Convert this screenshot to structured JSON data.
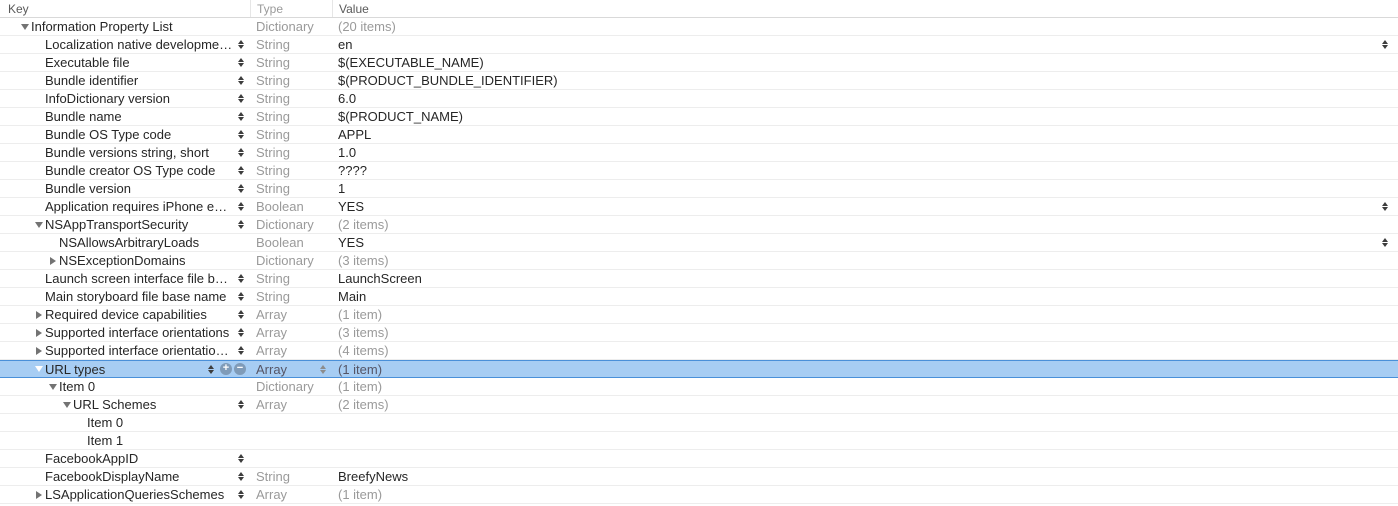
{
  "header": {
    "key": "Key",
    "type": "Type",
    "value": "Value"
  },
  "icons": {
    "plus": "+",
    "minus": "−"
  },
  "rows": [
    {
      "indent": 1,
      "arrow": "down",
      "key": "Information Property List",
      "keyStepper": false,
      "type": "Dictionary",
      "val": "(20 items)",
      "valGrey": true,
      "valStepper": false,
      "selected": false,
      "plusMinus": false
    },
    {
      "indent": 2,
      "arrow": "",
      "key": "Localization native development re...",
      "keyStepper": true,
      "type": "String",
      "val": "en",
      "valGrey": false,
      "valStepper": true,
      "selected": false,
      "plusMinus": false
    },
    {
      "indent": 2,
      "arrow": "",
      "key": "Executable file",
      "keyStepper": true,
      "type": "String",
      "val": "$(EXECUTABLE_NAME)",
      "valGrey": false,
      "valStepper": false,
      "selected": false,
      "plusMinus": false
    },
    {
      "indent": 2,
      "arrow": "",
      "key": "Bundle identifier",
      "keyStepper": true,
      "type": "String",
      "val": "$(PRODUCT_BUNDLE_IDENTIFIER)",
      "valGrey": false,
      "valStepper": false,
      "selected": false,
      "plusMinus": false
    },
    {
      "indent": 2,
      "arrow": "",
      "key": "InfoDictionary version",
      "keyStepper": true,
      "type": "String",
      "val": "6.0",
      "valGrey": false,
      "valStepper": false,
      "selected": false,
      "plusMinus": false
    },
    {
      "indent": 2,
      "arrow": "",
      "key": "Bundle name",
      "keyStepper": true,
      "type": "String",
      "val": "$(PRODUCT_NAME)",
      "valGrey": false,
      "valStepper": false,
      "selected": false,
      "plusMinus": false
    },
    {
      "indent": 2,
      "arrow": "",
      "key": "Bundle OS Type code",
      "keyStepper": true,
      "type": "String",
      "val": "APPL",
      "valGrey": false,
      "valStepper": false,
      "selected": false,
      "plusMinus": false
    },
    {
      "indent": 2,
      "arrow": "",
      "key": "Bundle versions string, short",
      "keyStepper": true,
      "type": "String",
      "val": "1.0",
      "valGrey": false,
      "valStepper": false,
      "selected": false,
      "plusMinus": false
    },
    {
      "indent": 2,
      "arrow": "",
      "key": "Bundle creator OS Type code",
      "keyStepper": true,
      "type": "String",
      "val": "????",
      "valGrey": false,
      "valStepper": false,
      "selected": false,
      "plusMinus": false
    },
    {
      "indent": 2,
      "arrow": "",
      "key": "Bundle version",
      "keyStepper": true,
      "type": "String",
      "val": "1",
      "valGrey": false,
      "valStepper": false,
      "selected": false,
      "plusMinus": false
    },
    {
      "indent": 2,
      "arrow": "",
      "key": "Application requires iPhone enviro...",
      "keyStepper": true,
      "type": "Boolean",
      "val": "YES",
      "valGrey": false,
      "valStepper": true,
      "selected": false,
      "plusMinus": false
    },
    {
      "indent": 2,
      "arrow": "down",
      "key": "NSAppTransportSecurity",
      "keyStepper": true,
      "type": "Dictionary",
      "val": "(2 items)",
      "valGrey": true,
      "valStepper": false,
      "selected": false,
      "plusMinus": false
    },
    {
      "indent": 3,
      "arrow": "",
      "key": "NSAllowsArbitraryLoads",
      "keyStepper": false,
      "type": "Boolean",
      "val": "YES",
      "valGrey": false,
      "valStepper": true,
      "selected": false,
      "plusMinus": false
    },
    {
      "indent": 3,
      "arrow": "right",
      "key": "NSExceptionDomains",
      "keyStepper": false,
      "type": "Dictionary",
      "val": "(3 items)",
      "valGrey": true,
      "valStepper": false,
      "selected": false,
      "plusMinus": false
    },
    {
      "indent": 2,
      "arrow": "",
      "key": "Launch screen interface file base...",
      "keyStepper": true,
      "type": "String",
      "val": "LaunchScreen",
      "valGrey": false,
      "valStepper": false,
      "selected": false,
      "plusMinus": false
    },
    {
      "indent": 2,
      "arrow": "",
      "key": "Main storyboard file base name",
      "keyStepper": true,
      "type": "String",
      "val": "Main",
      "valGrey": false,
      "valStepper": false,
      "selected": false,
      "plusMinus": false
    },
    {
      "indent": 2,
      "arrow": "right",
      "key": "Required device capabilities",
      "keyStepper": true,
      "type": "Array",
      "val": "(1 item)",
      "valGrey": true,
      "valStepper": false,
      "selected": false,
      "plusMinus": false
    },
    {
      "indent": 2,
      "arrow": "right",
      "key": "Supported interface orientations",
      "keyStepper": true,
      "type": "Array",
      "val": "(3 items)",
      "valGrey": true,
      "valStepper": false,
      "selected": false,
      "plusMinus": false
    },
    {
      "indent": 2,
      "arrow": "right",
      "key": "Supported interface orientations (i...",
      "keyStepper": true,
      "type": "Array",
      "val": "(4 items)",
      "valGrey": true,
      "valStepper": false,
      "selected": false,
      "plusMinus": false
    },
    {
      "indent": 2,
      "arrow": "down",
      "key": "URL types",
      "keyStepper": true,
      "type": "Array",
      "val": "(1 item)",
      "valGrey": true,
      "valStepper": false,
      "selected": true,
      "plusMinus": true,
      "typeStepper": true
    },
    {
      "indent": 3,
      "arrow": "down",
      "key": "Item 0",
      "keyStepper": false,
      "type": "Dictionary",
      "val": "(1 item)",
      "valGrey": true,
      "valStepper": false,
      "selected": false,
      "plusMinus": false
    },
    {
      "indent": 4,
      "arrow": "down",
      "key": "URL Schemes",
      "keyStepper": true,
      "type": "Array",
      "val": "(2 items)",
      "valGrey": true,
      "valStepper": false,
      "selected": false,
      "plusMinus": false
    },
    {
      "indent": 5,
      "arrow": "",
      "key": "Item 0",
      "keyStepper": false,
      "type": "",
      "val": "",
      "valGrey": false,
      "valStepper": false,
      "selected": false,
      "plusMinus": false,
      "redacted": true
    },
    {
      "indent": 5,
      "arrow": "",
      "key": "Item 1",
      "keyStepper": false,
      "type": "",
      "val": "",
      "valGrey": false,
      "valStepper": false,
      "selected": false,
      "plusMinus": false,
      "redacted": true
    },
    {
      "indent": 2,
      "arrow": "",
      "key": "FacebookAppID",
      "keyStepper": true,
      "type": "",
      "val": "",
      "valGrey": false,
      "valStepper": false,
      "selected": false,
      "plusMinus": false,
      "redacted": true
    },
    {
      "indent": 2,
      "arrow": "",
      "key": "FacebookDisplayName",
      "keyStepper": true,
      "type": "String",
      "val": "BreefyNews",
      "valGrey": false,
      "valStepper": false,
      "selected": false,
      "plusMinus": false
    },
    {
      "indent": 2,
      "arrow": "right",
      "key": "LSApplicationQueriesSchemes",
      "keyStepper": true,
      "type": "Array",
      "val": "(1 item)",
      "valGrey": true,
      "valStepper": false,
      "selected": false,
      "plusMinus": false
    }
  ]
}
